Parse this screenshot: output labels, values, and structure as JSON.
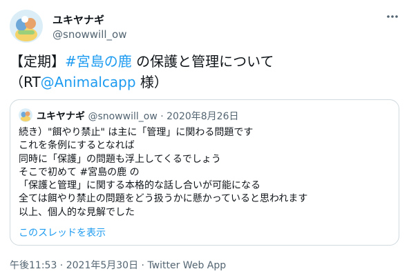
{
  "author": {
    "display_name": "ユキヤナギ",
    "handle": "@snowwill_ow",
    "avatar_icon": "avatar-illustration"
  },
  "tweet": {
    "line1_prefix": "【定期】",
    "hashtag": "#宮島の鹿",
    "line1_suffix": " の保護と管理について",
    "line2_prefix": "（RT",
    "mention": "@Animalcapp",
    "line2_suffix": " 様）"
  },
  "quote": {
    "display_name": "ユキヤナギ",
    "handle": "@snowwill_ow",
    "separator": " · ",
    "date": "2020年8月26日",
    "lines": [
      "続き）\"餌やり禁止\" は主に「管理」に関わる問題です",
      "これを条例にするとなれば",
      "同時に「保護」の問題も浮上してくるでしょう",
      "そこで初めて #宮島の鹿 の",
      "「保護と管理」に関する本格的な話し合いが可能になる",
      "全ては餌やり禁止の問題をどう扱うかに懸かっていると思われます",
      "以上、個人的な見解でした"
    ],
    "show_thread": "このスレッドを表示"
  },
  "footer": {
    "time": "午後11:53",
    "separator": " · ",
    "date": "2021年5月30日",
    "source": "Twitter Web App"
  },
  "colors": {
    "link": "#1d9bf0",
    "secondary_text": "#536471",
    "border": "#cfd9de"
  }
}
